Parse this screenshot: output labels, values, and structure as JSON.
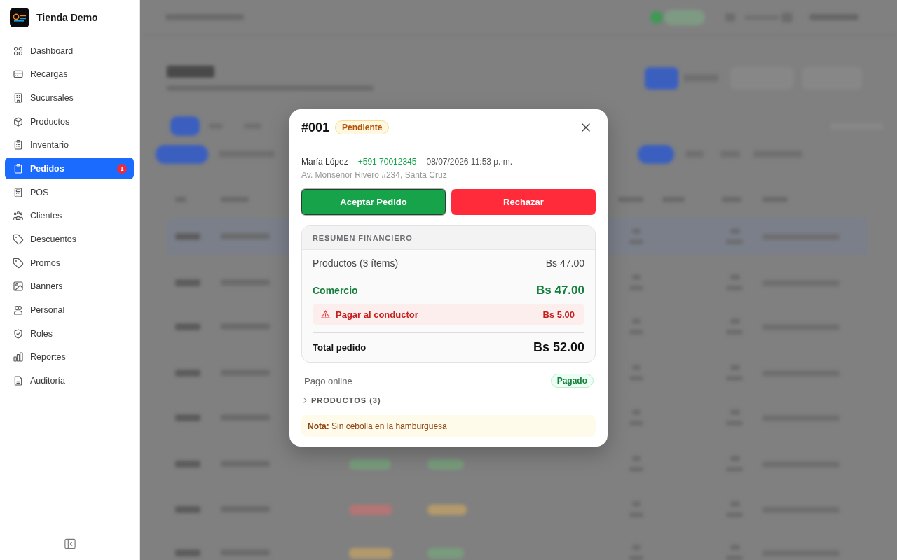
{
  "sidebar": {
    "store_name": "Tienda Demo",
    "items": [
      {
        "label": "Dashboard",
        "selected": false
      },
      {
        "label": "Recargas",
        "selected": false
      },
      {
        "label": "Sucursales",
        "selected": false
      },
      {
        "label": "Productos",
        "selected": false
      },
      {
        "label": "Inventario",
        "selected": false
      },
      {
        "label": "Pedidos",
        "selected": true,
        "badge": "1"
      },
      {
        "label": "POS",
        "selected": false
      },
      {
        "label": "Clientes",
        "selected": false
      },
      {
        "label": "Descuentos",
        "selected": false
      },
      {
        "label": "Promos",
        "selected": false
      },
      {
        "label": "Banners",
        "selected": false
      },
      {
        "label": "Personal",
        "selected": false
      },
      {
        "label": "Roles",
        "selected": false
      },
      {
        "label": "Reportes",
        "selected": false
      },
      {
        "label": "Auditoría",
        "selected": false
      }
    ]
  },
  "order_dialog": {
    "order_number": "#001",
    "status": "Pendiente",
    "customer": {
      "name": "María López",
      "phone": "+591 70012345",
      "datetime": "08/07/2026 11:53 p. m.",
      "address": "Av. Monseñor Rivero #234, Santa Cruz"
    },
    "actions": [
      {
        "label": "Aceptar Pedido",
        "kind": "accept",
        "focused": true
      },
      {
        "label": "Rechazar",
        "kind": "reject",
        "focused": false
      }
    ],
    "financial_summary": {
      "title": "RESUMEN FINANCIERO",
      "rows": [
        {
          "kind": "plain",
          "label": "Productos (3 ítems)",
          "amount": "Bs 47.00"
        },
        {
          "kind": "merchant",
          "label": "Comercio",
          "amount": "Bs 47.00"
        },
        {
          "kind": "alert",
          "label": "Pagar al conductor",
          "amount": "Bs 5.00"
        },
        {
          "kind": "total",
          "label": "Total pedido",
          "amount": "Bs 52.00"
        }
      ]
    },
    "payment": {
      "method": "Pago online",
      "status": "Pagado"
    },
    "products_section": {
      "label": "PRODUCTOS (3)",
      "expanded": false
    },
    "note": "**Nota:** Sin cebolla en la hamburguesa"
  }
}
